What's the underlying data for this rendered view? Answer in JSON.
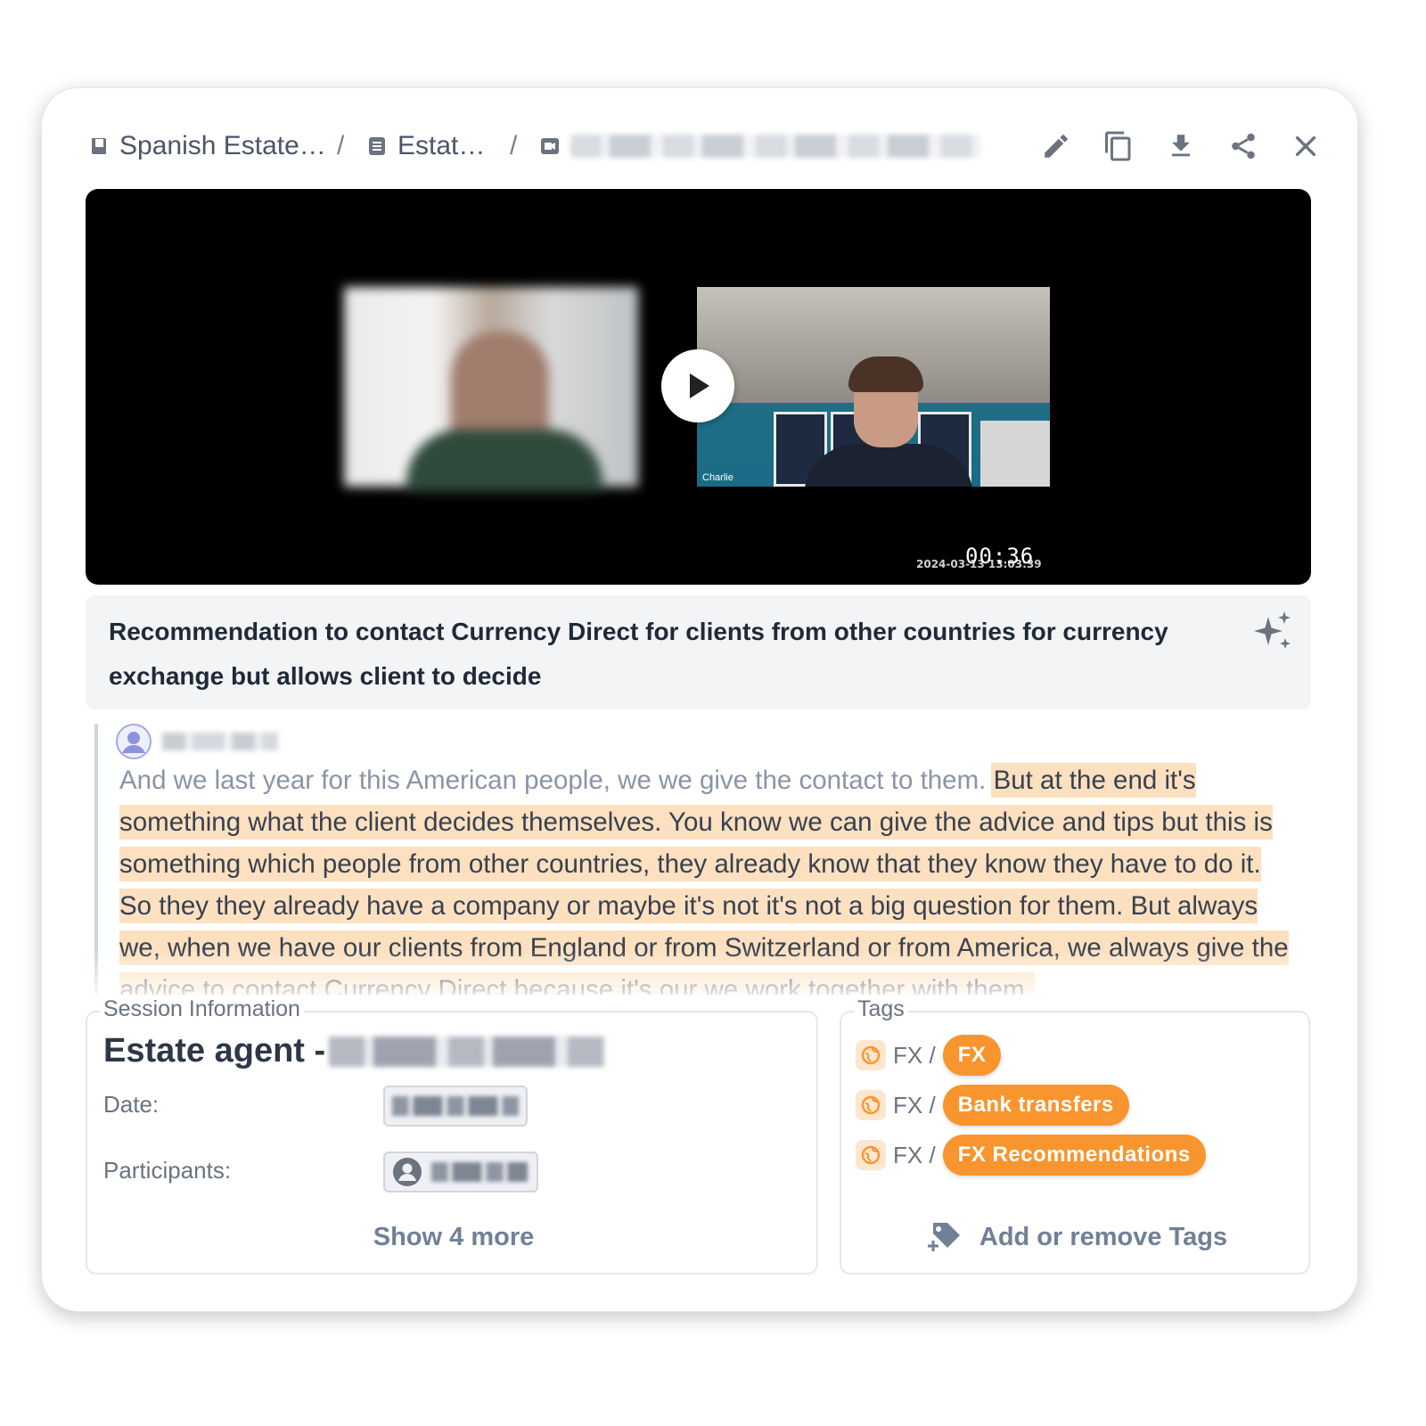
{
  "breadcrumb": {
    "items": [
      {
        "label": "Spanish Estate…",
        "icon": "book-icon"
      },
      {
        "label": "Estat…",
        "icon": "document-icon"
      },
      {
        "label": "",
        "icon": "video-icon"
      }
    ],
    "separator": "/"
  },
  "toolbar": {
    "buttons": [
      "edit-icon",
      "copy-icon",
      "download-icon",
      "share-icon",
      "close-icon"
    ]
  },
  "video": {
    "participant_label": "Charlie",
    "recording_timestamp": "2024-03-13 13:03:39",
    "duration": "00:36"
  },
  "summary": {
    "text": "Recommendation to contact Currency Direct for clients from other countries for currency exchange but allows client to decide"
  },
  "transcript": {
    "context_text": "And we last year for this American people, we we give the contact to them. ",
    "highlighted_text": "But at the end it's something what the client decides themselves. You know we can give the advice and tips but this is something which people from other countries, they already know that they know they have to do it. So they they already have a company or maybe it's not it's not a big question for them. But always we, when we have our clients from England or from Switzerland or from America, we always give the advice to contact Currency Direct because it's our we work together with them."
  },
  "session": {
    "legend": "Session Information",
    "title_prefix": "Estate agent -",
    "date_label": "Date:",
    "participants_label": "Participants:",
    "show_more": "Show 4 more"
  },
  "tags": {
    "legend": "Tags",
    "items": [
      {
        "prefix": "FX /",
        "label": "FX"
      },
      {
        "prefix": "FX /",
        "label": "Bank transfers"
      },
      {
        "prefix": "FX /",
        "label": "FX Recommendations"
      }
    ],
    "add_label": "Add or remove Tags"
  },
  "colors": {
    "tag_orange": "#f8952e",
    "highlight": "#fde0bf",
    "summary_bg": "#f3f4f6"
  }
}
